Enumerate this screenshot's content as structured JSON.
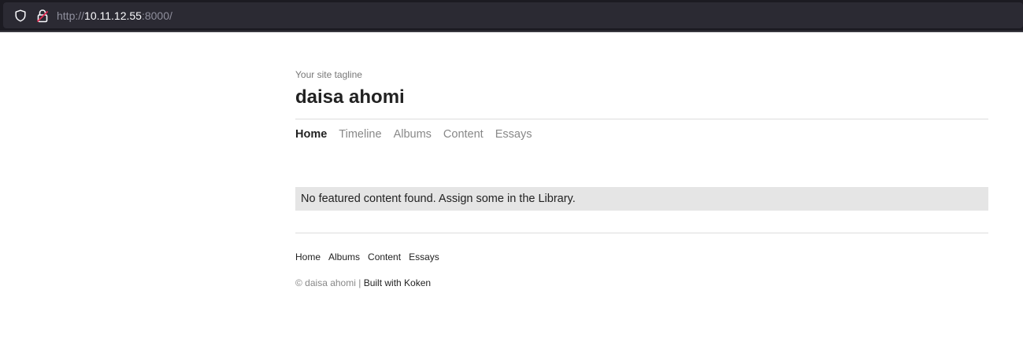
{
  "browser": {
    "url_scheme": "http://",
    "url_host": "10.11.12.55",
    "url_rest": ":8000/",
    "icons": [
      "shield-icon",
      "lock-insecure-icon"
    ]
  },
  "site": {
    "tagline": "Your site tagline",
    "title": "daisa ahomi"
  },
  "nav": {
    "items": [
      {
        "label": "Home",
        "active": true
      },
      {
        "label": "Timeline",
        "active": false
      },
      {
        "label": "Albums",
        "active": false
      },
      {
        "label": "Content",
        "active": false
      },
      {
        "label": "Essays",
        "active": false
      }
    ]
  },
  "main": {
    "notice": "No featured content found. Assign some in the Library."
  },
  "footer": {
    "nav": [
      "Home",
      "Albums",
      "Content",
      "Essays"
    ],
    "copyright": "© daisa ahomi |",
    "built_with": "Built with Koken"
  },
  "colors": {
    "browser_bg": "#1c1b22",
    "urlbar_bg": "#2b2a33",
    "text": "#222222",
    "muted": "#888888",
    "notice_bg": "#e5e5e5"
  }
}
